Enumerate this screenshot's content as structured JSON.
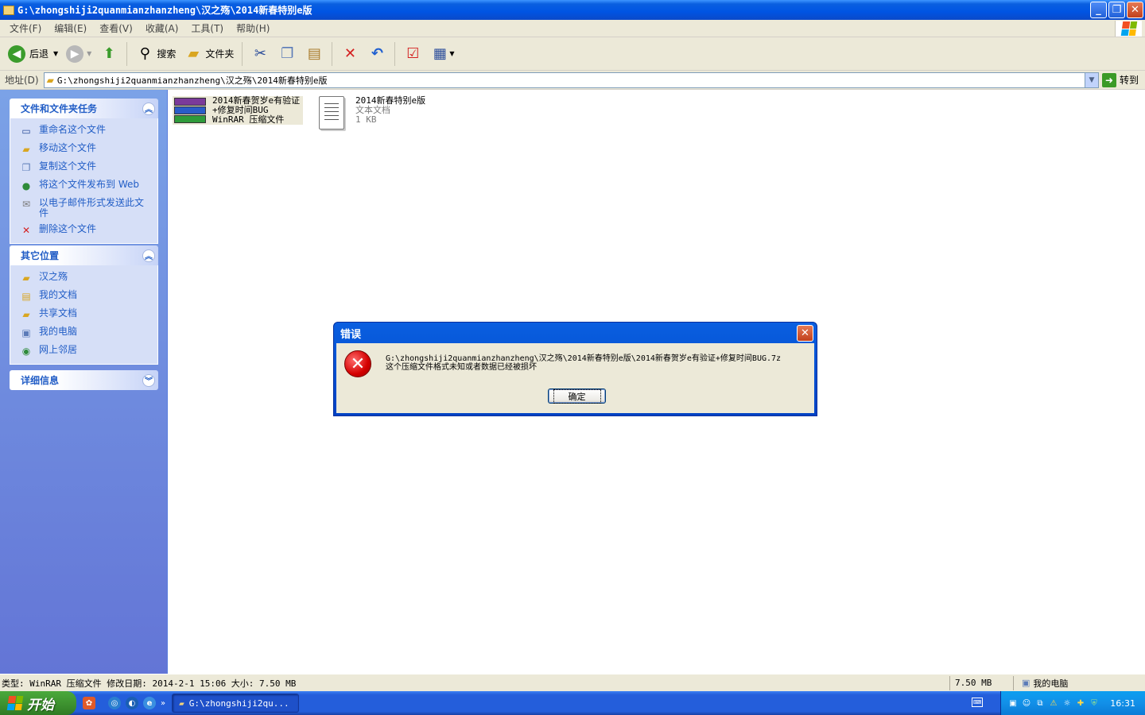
{
  "window": {
    "title": "G:\\zhongshiji2quanmianzhanzheng\\汉之殇\\2014新春特别e版",
    "minimize": "_",
    "restore": "❐",
    "close": "✕"
  },
  "menubar": {
    "items": [
      "文件(F)",
      "编辑(E)",
      "查看(V)",
      "收藏(A)",
      "工具(T)",
      "帮助(H)"
    ]
  },
  "toolbar": {
    "back_label": "后退",
    "search_label": "搜索",
    "folders_label": "文件夹"
  },
  "address": {
    "label": "地址(D)",
    "value": "G:\\zhongshiji2quanmianzhanzheng\\汉之殇\\2014新春特别e版",
    "go_label": "转到"
  },
  "tasks": {
    "title": "文件和文件夹任务",
    "items": [
      "重命名这个文件",
      "移动这个文件",
      "复制这个文件",
      "将这个文件发布到 Web",
      "以电子邮件形式发送此文件",
      "删除这个文件"
    ]
  },
  "places": {
    "title": "其它位置",
    "items": [
      "汉之殇",
      "我的文档",
      "共享文档",
      "我的电脑",
      "网上邻居"
    ]
  },
  "details": {
    "title": "详细信息"
  },
  "files": [
    {
      "name_line1": "2014新春贺岁e有验证",
      "name_line2": "+修复时间BUG",
      "type": "WinRAR 压缩文件",
      "icon": "winrar-archive-icon"
    },
    {
      "name_line1": "2014新春特别e版",
      "type": "文本文档",
      "size": "1 KB",
      "icon": "text-document-icon"
    }
  ],
  "dialog": {
    "title": "错误",
    "message_line1": "G:\\zhongshiji2quanmianzhanzheng\\汉之殇\\2014新春特别e版\\2014新春贺岁e有验证+修复时间BUG.7z",
    "message_line2": "这个压缩文件格式未知或者数据已经被损坏",
    "ok_label": "确定"
  },
  "statusbar": {
    "info": "类型: WinRAR 压缩文件 修改日期: 2014-2-1 15:06 大小: 7.50 MB",
    "size": "7.50 MB",
    "location": "我的电脑"
  },
  "taskbar": {
    "start_label": "开始",
    "task_label": "G:\\zhongshiji2qu...",
    "clock": "16:31"
  },
  "colors": {
    "titlebar": "#0054e3",
    "sidebar": "#6375d6",
    "link": "#215dc6",
    "dialog_error": "#d40000"
  }
}
